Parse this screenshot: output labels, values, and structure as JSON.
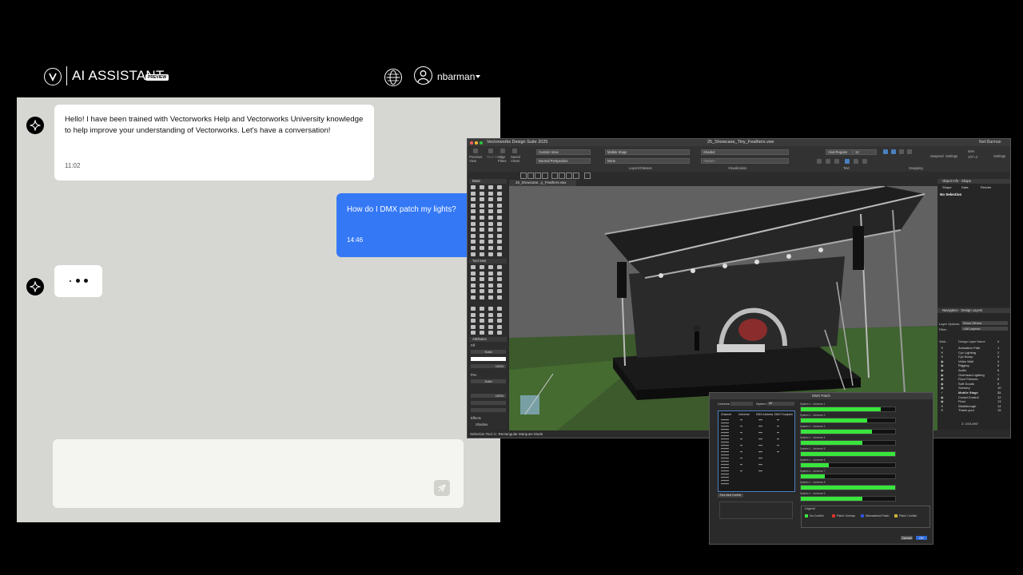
{
  "chat": {
    "app_title": "AI ASSISTANT",
    "badge": "PREVIEW",
    "username": "nbarman",
    "icons": [
      "vectorworks-logo-icon",
      "globe-icon",
      "user-icon",
      "caret-down-icon",
      "assistant-sparkle-icon",
      "send-icon"
    ],
    "messages": [
      {
        "role": "assistant",
        "text": "Hello! I have been trained with Vectorworks Help and Vectorworks University knowledge to help improve your understanding of Vectorworks. Let's have a conversation!",
        "time": "11:02"
      },
      {
        "role": "user",
        "text": "How do I DMX patch my lights?",
        "time": "14:46"
      }
    ],
    "input_placeholder": ""
  },
  "vectorworks": {
    "app_title": "Vectorworks Design Suite 2025",
    "doc_title": "25_Showcase_Tiny_Feathers.vwx",
    "user": "Neil Barman",
    "doc_tab": "25_Showcase...y_Feathers.vwx",
    "toolbar": {
      "previous_view": "Previous View",
      "next_view": "Next View",
      "align_plane": "Align Plane",
      "saved_views": "Saved Views",
      "view": "Custom View",
      "render_mode": "Normal Perspective",
      "layer": "Mobile Stage",
      "class": "None",
      "render": "Shaded",
      "layers_classes_label": "Layers/Classes",
      "visualization_label": "Visualization",
      "font": "Arial Regular",
      "font_size": "12",
      "text_label": "Text",
      "snapping_label": "Snapping",
      "suspend": "Suspend",
      "settings": "Settings",
      "zoom": "64%",
      "scale": "1/4\"=1'"
    },
    "palettes": {
      "basic": "Basic",
      "tool_sets": "Tool Sets",
      "attributes": "Attributes",
      "fill": "Fill",
      "fill_value": "Solid",
      "pen": "Pen",
      "pen_value": "Solid",
      "opacity": "100%",
      "effects": "Effects",
      "shadow": "Shadow"
    },
    "obj_info": {
      "title": "Object Info - Shape",
      "tabs": [
        "Shape",
        "Data",
        "Render"
      ],
      "selection": "No Selection"
    },
    "navigation": {
      "title": "Navigation - Design Layers",
      "layer_options_label": "Layer Options:",
      "layer_options_value": "Show Others",
      "filter_label": "Filter:",
      "filter_value": "<All Layers>",
      "col_visibility": "Visib...",
      "col_name": "Design Layer Name",
      "col_number": "#",
      "layers": [
        {
          "name": "Animation Path",
          "no": "1",
          "vis": "✕"
        },
        {
          "name": "Cyc Lighting",
          "no": "2",
          "vis": "✕"
        },
        {
          "name": "Cyc Bump",
          "no": "3",
          "vis": "✕"
        },
        {
          "name": "Video Wall",
          "no": "4",
          "vis": "◉"
        },
        {
          "name": "Rigging",
          "no": "5",
          "vis": "◉"
        },
        {
          "name": "Audio",
          "no": "6",
          "vis": "◉"
        },
        {
          "name": "Overhead Lighting",
          "no": "7",
          "vis": "◉"
        },
        {
          "name": "Floor Fixtures",
          "no": "8",
          "vis": "◉"
        },
        {
          "name": "Soft Goods",
          "no": "9",
          "vis": "◉"
        },
        {
          "name": "Scenery",
          "no": "10",
          "vis": "◉"
        },
        {
          "name": "Mobile Stage",
          "no": "11",
          "vis": "✓"
        },
        {
          "name": "Crowd Control",
          "no": "12",
          "vis": "◉"
        },
        {
          "name": "Floor",
          "no": "13",
          "vis": "◉"
        },
        {
          "name": "Walkthrough",
          "no": "14",
          "vis": "✕"
        },
        {
          "name": "Thank you!",
          "no": "15",
          "vis": "✕"
        }
      ],
      "coords": "Z: 24'8.490\""
    },
    "status": "Selection Tool  ⊙: Rectangular Marquee Mode"
  },
  "dmx": {
    "title": "DMX Patch",
    "universe_label": "Universe",
    "system_label": "System",
    "system_value": "All",
    "table_headers": [
      "Channel",
      "Universe",
      "DMX Address",
      "DMX Footprint"
    ],
    "universes": [
      {
        "label": "System 1 - Universe 1",
        "fill": 0.85
      },
      {
        "label": "System 1 - Universe 2",
        "fill": 0.7
      },
      {
        "label": "System 1 - Universe 3",
        "fill": 0.75
      },
      {
        "label": "System 1 - Universe 4",
        "fill": 0.65
      },
      {
        "label": "System 1 - Universe 5",
        "fill": 1.0
      },
      {
        "label": "System 1 - Universe 6",
        "fill": 0.3
      },
      {
        "label": "System 1 - Universe 7",
        "fill": 0.25
      },
      {
        "label": "System 1 - Universe 8",
        "fill": 1.0
      },
      {
        "label": "System 1 - Universe 9",
        "fill": 0.65
      }
    ],
    "find_next_conflict": "Find Next Conflict",
    "legend": "Legend",
    "legend_items": [
      "No Conflict",
      "Patch Overlap",
      "Mismatched Patch",
      "Patch Conflict"
    ],
    "colors": {
      "green": "#39e53c",
      "overlap": "#d8342b",
      "mismatch": "#2f54d6",
      "conflict": "#c9b23a"
    },
    "cancel": "Cancel",
    "ok": "OK"
  }
}
